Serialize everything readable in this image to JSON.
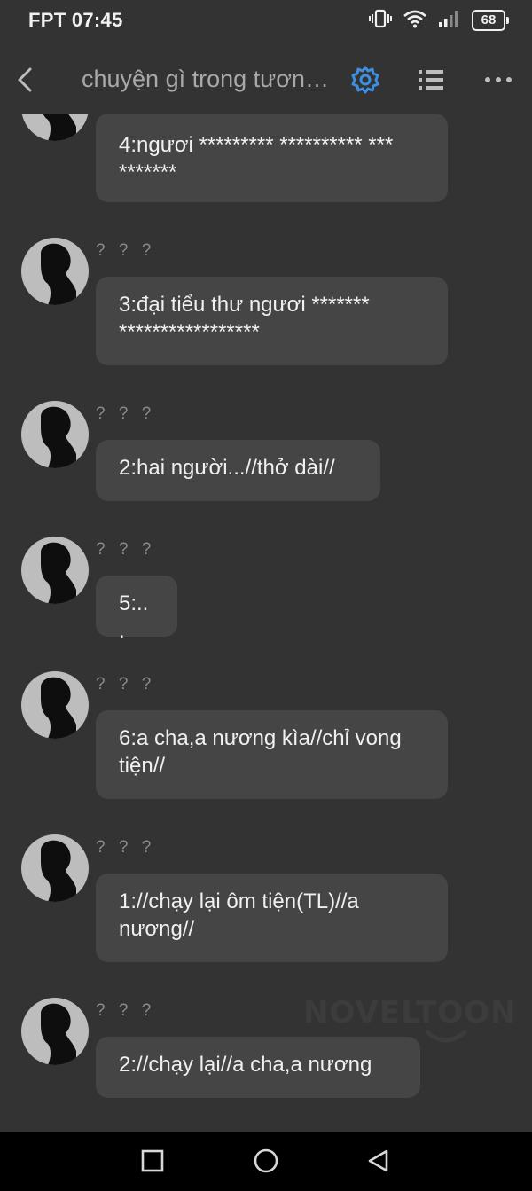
{
  "status_bar": {
    "carrier_time": "FPT 07:45",
    "battery_level": "68",
    "icons": [
      "vibrate-icon",
      "wifi-icon",
      "signal-icon",
      "battery-icon"
    ]
  },
  "header": {
    "back_icon": "back-arrow-icon",
    "title": "chuyện gì trong tương lai",
    "settings_icon": "gear-icon",
    "list_icon": "list-icon",
    "more_icon": "more-horizontal-icon",
    "accent_color": "#3d8fe0"
  },
  "messages": [
    {
      "sender": "",
      "text": "4:ngươi ********* ********** *** *******"
    },
    {
      "sender": "? ? ?",
      "text": "3:đại tiểu thư ngươi ******* *****************"
    },
    {
      "sender": "? ? ?",
      "text": "2:hai người...//thở dài//"
    },
    {
      "sender": "? ? ?",
      "text": "5:..."
    },
    {
      "sender": "? ? ?",
      "text": "6:a cha,a nương kìa//chỉ vong tiện//"
    },
    {
      "sender": "? ? ?",
      "text": "1://chạy lại ôm tiện(TL)//a nương//"
    },
    {
      "sender": "? ? ?",
      "text": "2://chạy lại//a cha,a nương"
    }
  ],
  "watermark": "NOVELTOON",
  "system_nav": {
    "icons": [
      "recents-square-icon",
      "home-circle-icon",
      "back-triangle-icon"
    ]
  }
}
